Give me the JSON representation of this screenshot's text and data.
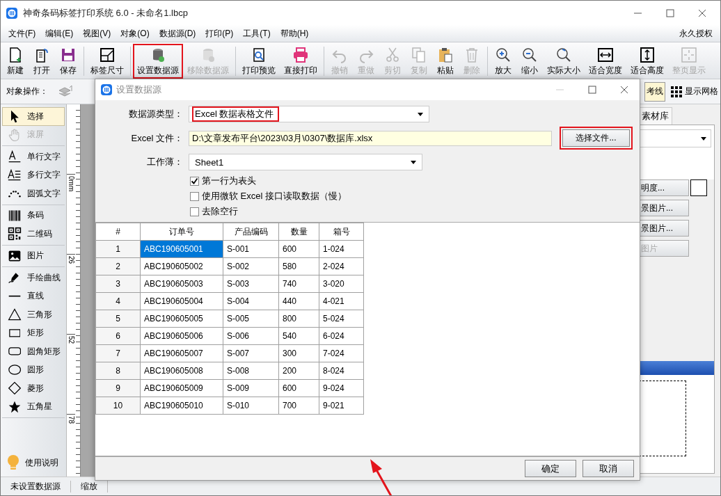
{
  "window": {
    "title": "神奇条码标签打印系统 6.0 - 未命名1.lbcp"
  },
  "menu": {
    "items": [
      "文件(F)",
      "编辑(E)",
      "视图(V)",
      "对象(O)",
      "数据源(D)",
      "打印(P)",
      "工具(T)",
      "帮助(H)"
    ],
    "license": "永久授权"
  },
  "toolbar": {
    "items": [
      {
        "label": "新建",
        "disabled": false,
        "highlighted": false,
        "separator_before": false
      },
      {
        "label": "打开",
        "disabled": false,
        "highlighted": false,
        "separator_before": false
      },
      {
        "label": "保存",
        "disabled": false,
        "highlighted": false,
        "separator_before": false
      },
      {
        "label": "标签尺寸",
        "disabled": false,
        "highlighted": false,
        "separator_before": true
      },
      {
        "label": "设置数据源",
        "disabled": false,
        "highlighted": true,
        "separator_before": true
      },
      {
        "label": "移除数据源",
        "disabled": true,
        "highlighted": false,
        "separator_before": false
      },
      {
        "label": "打印预览",
        "disabled": false,
        "highlighted": false,
        "separator_before": true
      },
      {
        "label": "直接打印",
        "disabled": false,
        "highlighted": false,
        "separator_before": false
      },
      {
        "label": "撤销",
        "disabled": true,
        "highlighted": false,
        "separator_before": true
      },
      {
        "label": "重做",
        "disabled": true,
        "highlighted": false,
        "separator_before": false
      },
      {
        "label": "剪切",
        "disabled": true,
        "highlighted": false,
        "separator_before": false
      },
      {
        "label": "复制",
        "disabled": true,
        "highlighted": false,
        "separator_before": false
      },
      {
        "label": "粘贴",
        "disabled": false,
        "highlighted": false,
        "separator_before": false
      },
      {
        "label": "删除",
        "disabled": true,
        "highlighted": false,
        "separator_before": false
      },
      {
        "label": "放大",
        "disabled": false,
        "highlighted": false,
        "separator_before": true
      },
      {
        "label": "缩小",
        "disabled": false,
        "highlighted": false,
        "separator_before": false
      },
      {
        "label": "实际大小",
        "disabled": false,
        "highlighted": false,
        "separator_before": false
      },
      {
        "label": "适合宽度",
        "disabled": false,
        "highlighted": false,
        "separator_before": false
      },
      {
        "label": "适合高度",
        "disabled": false,
        "highlighted": false,
        "separator_before": false
      },
      {
        "label": "整页显示",
        "disabled": true,
        "highlighted": false,
        "separator_before": false
      }
    ]
  },
  "object_bar": {
    "label": "对象操作：",
    "toggles": [
      {
        "label": "考线",
        "on": true
      },
      {
        "label": "显示网格",
        "on": false
      }
    ]
  },
  "tools": {
    "groups": [
      {
        "items": [
          {
            "label": "选择",
            "selected": true,
            "disabled": false
          },
          {
            "label": "滚屏",
            "selected": false,
            "disabled": true
          }
        ]
      },
      {
        "items": [
          {
            "label": "单行文字",
            "selected": false,
            "disabled": false
          },
          {
            "label": "多行文字",
            "selected": false,
            "disabled": false
          },
          {
            "label": "圆弧文字",
            "selected": false,
            "disabled": false
          }
        ]
      },
      {
        "items": [
          {
            "label": "条码",
            "selected": false,
            "disabled": false
          },
          {
            "label": "二维码",
            "selected": false,
            "disabled": false
          }
        ]
      },
      {
        "items": [
          {
            "label": "图片",
            "selected": false,
            "disabled": false
          }
        ]
      },
      {
        "items": [
          {
            "label": "手绘曲线",
            "selected": false,
            "disabled": false
          },
          {
            "label": "直线",
            "selected": false,
            "disabled": false
          },
          {
            "label": "三角形",
            "selected": false,
            "disabled": false
          },
          {
            "label": "矩形",
            "selected": false,
            "disabled": false
          },
          {
            "label": "圆角矩形",
            "selected": false,
            "disabled": false
          },
          {
            "label": "圆形",
            "selected": false,
            "disabled": false
          },
          {
            "label": "菱形",
            "selected": false,
            "disabled": false
          },
          {
            "label": "五角星",
            "selected": false,
            "disabled": false
          }
        ]
      }
    ],
    "help": "使用说明"
  },
  "ruler": {
    "labels": [
      "0mm",
      "26",
      "52",
      "78"
    ]
  },
  "right_panel": {
    "tab": "素材库",
    "buttons": [
      {
        "label": "明度...",
        "disabled": false,
        "swatch": true
      },
      {
        "label": "景图片...",
        "disabled": false,
        "swatch": false
      },
      {
        "label": "景图片...",
        "disabled": false,
        "swatch": false
      },
      {
        "label": "图片",
        "disabled": true,
        "swatch": false
      }
    ]
  },
  "status_bar": {
    "items": [
      "未设置数据源",
      "缩放"
    ]
  },
  "dialog": {
    "title": "设置数据源",
    "fields": [
      {
        "kind": "select",
        "label": "数据源类型：",
        "value": "Excel 数据表格文件",
        "highlighted": true
      },
      {
        "kind": "file",
        "label": "Excel 文件：",
        "value": "D:\\文章发布平台\\2023\\03月\\0307\\数据库.xlsx",
        "button": "选择文件...",
        "highlighted": true
      },
      {
        "kind": "select",
        "label": "工作薄：",
        "value": "Sheet1",
        "highlighted": false
      }
    ],
    "options": [
      {
        "label": "第一行为表头",
        "checked": true
      },
      {
        "label": "使用微软 Excel 接口读取数据（慢）",
        "checked": false
      },
      {
        "label": "去除空行",
        "checked": false
      }
    ],
    "table": {
      "columns": [
        "#",
        "订单号",
        "产品编码",
        "数量",
        "箱号"
      ],
      "rows": [
        {
          "cells": [
            "1",
            "ABC190605001",
            "S-001",
            "600",
            "1-024"
          ],
          "selected": true
        },
        {
          "cells": [
            "2",
            "ABC190605002",
            "S-002",
            "580",
            "2-024"
          ],
          "selected": false
        },
        {
          "cells": [
            "3",
            "ABC190605003",
            "S-003",
            "740",
            "3-020"
          ],
          "selected": false
        },
        {
          "cells": [
            "4",
            "ABC190605004",
            "S-004",
            "440",
            "4-021"
          ],
          "selected": false
        },
        {
          "cells": [
            "5",
            "ABC190605005",
            "S-005",
            "800",
            "5-024"
          ],
          "selected": false
        },
        {
          "cells": [
            "6",
            "ABC190605006",
            "S-006",
            "540",
            "6-024"
          ],
          "selected": false
        },
        {
          "cells": [
            "7",
            "ABC190605007",
            "S-007",
            "300",
            "7-024"
          ],
          "selected": false
        },
        {
          "cells": [
            "8",
            "ABC190605008",
            "S-008",
            "200",
            "8-024"
          ],
          "selected": false
        },
        {
          "cells": [
            "9",
            "ABC190605009",
            "S-009",
            "600",
            "9-024"
          ],
          "selected": false
        },
        {
          "cells": [
            "10",
            "ABC190605010",
            "S-010",
            "700",
            "9-021"
          ],
          "selected": false
        }
      ]
    },
    "buttons": [
      "确定",
      "取消"
    ]
  }
}
